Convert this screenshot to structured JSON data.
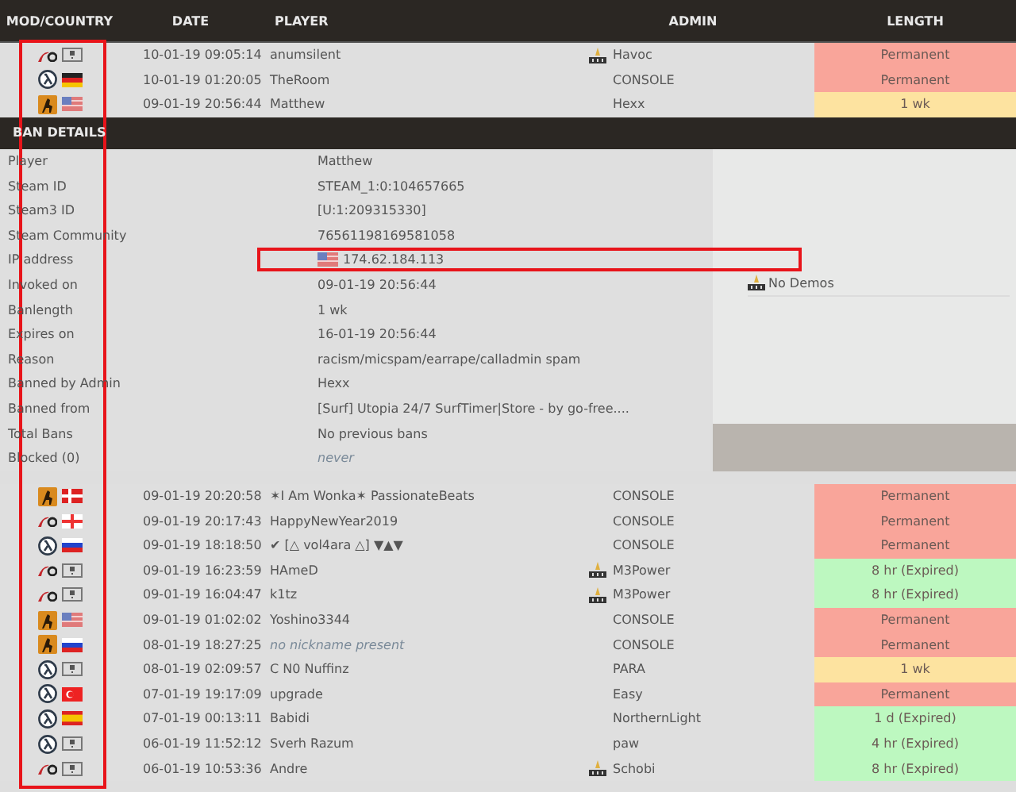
{
  "columns": [
    {
      "label": "MOD/COUNTRY",
      "highlighted": true
    },
    {
      "label": "DATE",
      "highlighted": false
    },
    {
      "label": "PLAYER",
      "highlighted": false
    },
    {
      "label": "ADMIN",
      "highlighted": false
    },
    {
      "label": "LENGTH",
      "highlighted": false
    }
  ],
  "top_rows": [
    {
      "mod": {
        "kind": "swoosh"
      },
      "flag": {
        "kind": "unknown"
      },
      "date": "10-01-19 09:05:14",
      "player": "anumsilent",
      "nickname_missing": false,
      "admin": "Havoc",
      "admin_icon": true,
      "length": "Permanent",
      "color": "#f9a59a"
    },
    {
      "mod": {
        "kind": "lambda"
      },
      "flag": {
        "kind": "de"
      },
      "date": "10-01-19 01:20:05",
      "player": "TheRoom",
      "nickname_missing": false,
      "admin": "CONSOLE",
      "admin_icon": false,
      "length": "Permanent",
      "color": "#f9a59a"
    },
    {
      "mod": {
        "kind": "soldier"
      },
      "flag": {
        "kind": "us"
      },
      "date": "09-01-19 20:56:44",
      "player": "Matthew",
      "nickname_missing": false,
      "admin": "Hexx",
      "admin_icon": false,
      "length": "1 wk",
      "color": "#fde3a0"
    }
  ],
  "ban_details": {
    "title": "BAN DETAILS",
    "items": [
      {
        "label": "Player",
        "value": "Matthew",
        "muted": false,
        "highlighted": false
      },
      {
        "label": "Steam ID",
        "value": "STEAM_1:0:104657665",
        "muted": false,
        "highlighted": false
      },
      {
        "label": "Steam3 ID",
        "value": "[U:1:209315330]",
        "muted": false,
        "highlighted": false
      },
      {
        "label": "Steam Community",
        "value": "76561198169581058",
        "muted": false,
        "highlighted": false
      },
      {
        "label": "IP address",
        "value": "174.62.184.113",
        "flag": {
          "kind": "us"
        },
        "muted": false,
        "highlighted": true
      },
      {
        "label": "Invoked on",
        "value": "09-01-19 20:56:44",
        "muted": false,
        "highlighted": false
      },
      {
        "label": "Banlength",
        "value": "1 wk",
        "muted": false,
        "highlighted": false
      },
      {
        "label": "Expires on",
        "value": "16-01-19 20:56:44",
        "muted": false,
        "highlighted": false
      },
      {
        "label": "Reason",
        "value": "racism/micspam/earrape/calladmin spam",
        "muted": false,
        "highlighted": false
      },
      {
        "label": "Banned by Admin",
        "value": "Hexx",
        "muted": false,
        "highlighted": false
      },
      {
        "label": "Banned from",
        "value": "[Surf] Utopia 24/7 SurfTimer|Store - by go-free....",
        "muted": false,
        "highlighted": false
      },
      {
        "label": "Total Bans",
        "value": "No previous bans",
        "muted": false,
        "highlighted": false
      },
      {
        "label": "Blocked (0)",
        "value": "never",
        "muted": true,
        "highlighted": false
      }
    ],
    "demos": "No Demos"
  },
  "rows": [
    {
      "mod": {
        "kind": "soldier"
      },
      "flag": {
        "kind": "dk"
      },
      "date": "09-01-19 20:20:58",
      "player": "✶I Am Wonka✶ PassionateBeats",
      "nickname_missing": false,
      "admin": "CONSOLE",
      "admin_icon": false,
      "length": "Permanent",
      "color": "#f9a59a"
    },
    {
      "mod": {
        "kind": "swoosh"
      },
      "flag": {
        "kind": "ge"
      },
      "date": "09-01-19 20:17:43",
      "player": "HappyNewYear2019",
      "nickname_missing": false,
      "admin": "CONSOLE",
      "admin_icon": false,
      "length": "Permanent",
      "color": "#f9a59a"
    },
    {
      "mod": {
        "kind": "lambda"
      },
      "flag": {
        "kind": "ru"
      },
      "date": "09-01-19 18:18:50",
      "player": "✔ [△ vol4ara △] ▼▲▼",
      "nickname_missing": false,
      "admin": "CONSOLE",
      "admin_icon": false,
      "length": "Permanent",
      "color": "#f9a59a"
    },
    {
      "mod": {
        "kind": "swoosh"
      },
      "flag": {
        "kind": "unknown"
      },
      "date": "09-01-19 16:23:59",
      "player": "HAmeD",
      "nickname_missing": false,
      "admin": "M3Power",
      "admin_icon": true,
      "length": "8 hr (Expired)",
      "color": "#bdf8c0"
    },
    {
      "mod": {
        "kind": "swoosh"
      },
      "flag": {
        "kind": "unknown"
      },
      "date": "09-01-19 16:04:47",
      "player": "k1tz",
      "nickname_missing": false,
      "admin": "M3Power",
      "admin_icon": true,
      "length": "8 hr (Expired)",
      "color": "#bdf8c0"
    },
    {
      "mod": {
        "kind": "soldier"
      },
      "flag": {
        "kind": "us"
      },
      "date": "09-01-19 01:02:02",
      "player": "Yoshino3344",
      "nickname_missing": false,
      "admin": "CONSOLE",
      "admin_icon": false,
      "length": "Permanent",
      "color": "#f9a59a"
    },
    {
      "mod": {
        "kind": "soldier"
      },
      "flag": {
        "kind": "ru"
      },
      "date": "08-01-19 18:27:25",
      "player": "no nickname present",
      "nickname_missing": true,
      "admin": "CONSOLE",
      "admin_icon": false,
      "length": "Permanent",
      "color": "#f9a59a"
    },
    {
      "mod": {
        "kind": "lambda"
      },
      "flag": {
        "kind": "unknown"
      },
      "date": "08-01-19 02:09:57",
      "player": "C N0 Nuffinz",
      "nickname_missing": false,
      "admin": "PARA",
      "admin_icon": false,
      "length": "1 wk",
      "color": "#fde3a0"
    },
    {
      "mod": {
        "kind": "lambda"
      },
      "flag": {
        "kind": "tr"
      },
      "date": "07-01-19 19:17:09",
      "player": "upgrade",
      "nickname_missing": false,
      "admin": "Easy",
      "admin_icon": false,
      "length": "Permanent",
      "color": "#f9a59a"
    },
    {
      "mod": {
        "kind": "lambda"
      },
      "flag": {
        "kind": "es"
      },
      "date": "07-01-19 00:13:11",
      "player": "Babidi",
      "nickname_missing": false,
      "admin": "NorthernLight",
      "admin_icon": false,
      "length": "1 d (Expired)",
      "color": "#bdf8c0"
    },
    {
      "mod": {
        "kind": "lambda"
      },
      "flag": {
        "kind": "unknown"
      },
      "date": "06-01-19 11:52:12",
      "player": "Sverh Razum",
      "nickname_missing": false,
      "admin": "paw",
      "admin_icon": false,
      "length": "4 hr (Expired)",
      "color": "#bdf8c0"
    },
    {
      "mod": {
        "kind": "swoosh"
      },
      "flag": {
        "kind": "unknown"
      },
      "date": "06-01-19 10:53:36",
      "player": "Andre",
      "nickname_missing": false,
      "admin": "Schobi",
      "admin_icon": true,
      "length": "8 hr (Expired)",
      "color": "#bdf8c0"
    }
  ]
}
